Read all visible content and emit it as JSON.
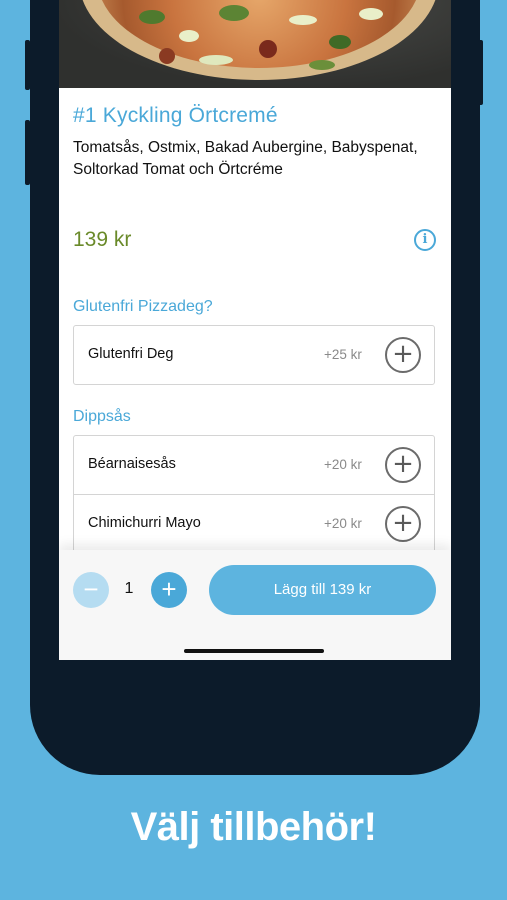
{
  "product": {
    "title": "#1 Kyckling Örtcremé",
    "description": "Tomatsås, Ostmix, Bakad Aubergine, Babyspenat, Soltorkad Tomat och Örtcréme",
    "price": "139 kr",
    "info_icon": "info-icon"
  },
  "sections": [
    {
      "title": "Glutenfri Pizzadeg?",
      "options": [
        {
          "name": "Glutenfri Deg",
          "price": "+25 kr"
        }
      ]
    },
    {
      "title": "Dippsås",
      "options": [
        {
          "name": "Béarnaisesås",
          "price": "+20 kr"
        },
        {
          "name": "Chimichurri Mayo",
          "price": "+20 kr"
        }
      ]
    }
  ],
  "icons": {
    "plus": "+",
    "minus": "−",
    "info": "i"
  },
  "cart": {
    "quantity": "1",
    "add_label": "Lägg till 139 kr"
  },
  "caption": "Välj tillbehör!",
  "colors": {
    "accent": "#4aa8d8",
    "background": "#5db4df",
    "price": "#6a8a2a",
    "phone": "#0c1b2a"
  }
}
